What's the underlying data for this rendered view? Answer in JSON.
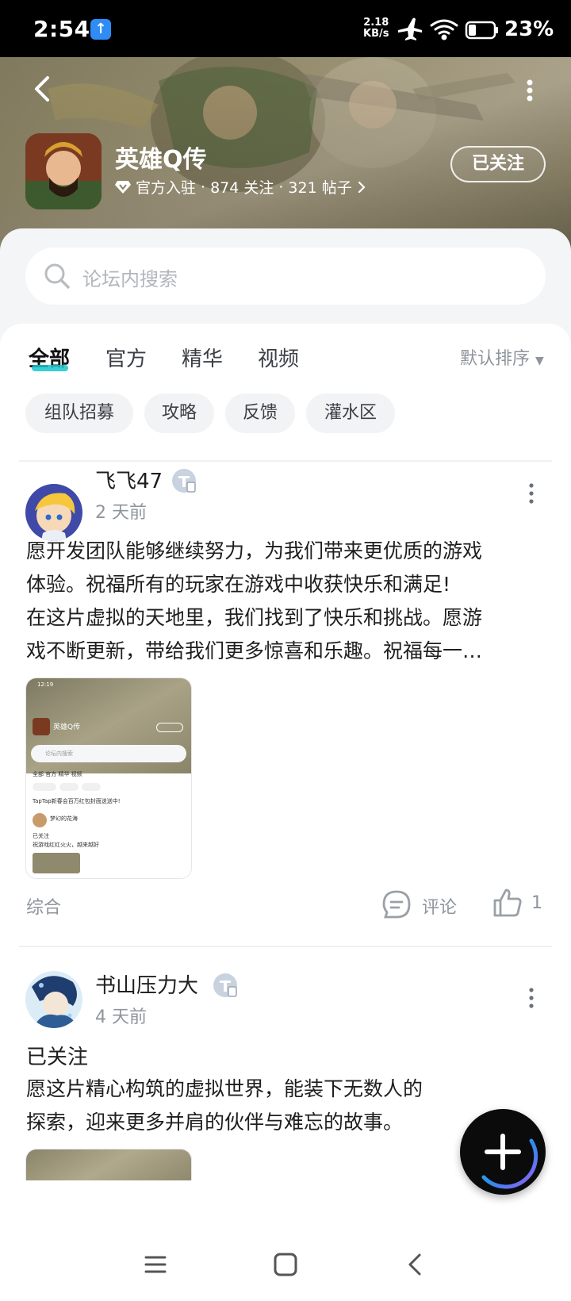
{
  "status_bar": {
    "time": "2:54",
    "speed_value": "2.18",
    "speed_unit": "KB/s",
    "battery": "23%"
  },
  "header": {
    "game_title": "英雄Q传",
    "meta": [
      "官方入驻",
      "874 关注",
      "321 帖子"
    ],
    "meta_sep": "·",
    "follow_label": "已关注"
  },
  "search": {
    "placeholder": "论坛内搜索"
  },
  "tabs": [
    {
      "label": "全部",
      "active": true
    },
    {
      "label": "官方",
      "active": false
    },
    {
      "label": "精华",
      "active": false
    },
    {
      "label": "视频",
      "active": false
    }
  ],
  "sort_label": "默认排序",
  "chips": [
    "组队招募",
    "攻略",
    "反馈",
    "灌水区"
  ],
  "posts": [
    {
      "user": "飞飞47",
      "time": "2 天前",
      "text_lines": [
        "愿开发团队能够继续努力，为我们带来更优质的游戏",
        "体验。祝福所有的玩家在游戏中收获快乐和满足!",
        "在这片虚拟的天地里，我们找到了快乐和挑战。愿游",
        "戏不断更新，带给我们更多惊喜和乐趣。祝福每一…"
      ],
      "category": "综合",
      "comment_label": "评论",
      "likes": "1",
      "thumb": {
        "time": "12:19",
        "title": "英雄Q传",
        "tabs": "全部  官方  精华  视频",
        "search": "论坛内搜索",
        "notice": "TapTap新春会百万红包封面送送中!",
        "user": "梦幻的花海",
        "follow": "已关注",
        "text": "祝游戏红红火火，越来越好"
      }
    },
    {
      "user": "书山压力大",
      "time": "4 天前",
      "heading": "已关注",
      "text_lines": [
        "愿这片精心构筑的虚拟世界，能装下无数人的",
        "探索，迎来更多并肩的伙伴与难忘的故事。"
      ]
    }
  ]
}
